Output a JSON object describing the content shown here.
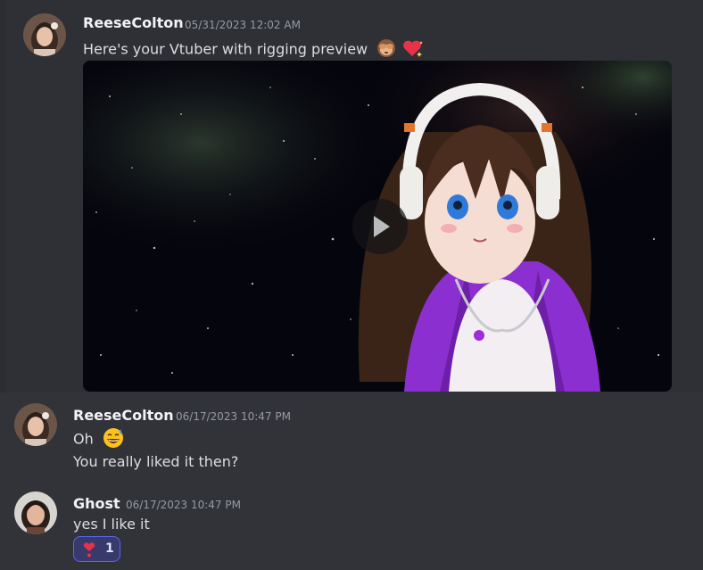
{
  "messages": [
    {
      "username": "ReeseColton",
      "timestamp": "05/31/2023 12:02 AM",
      "text": "Here's your Vtuber with rigging preview",
      "emojis": [
        "see-no-evil-monkey",
        "sparkling-heart"
      ],
      "attachment": {
        "type": "video",
        "icon": "play-icon"
      }
    },
    {
      "username": "ReeseColton",
      "timestamp": "06/17/2023 10:47 PM",
      "lines": [
        "Oh",
        "You really liked it then?"
      ],
      "emoji": "grinning-sweat-face"
    },
    {
      "username": "Ghost",
      "timestamp": "06/17/2023 10:47 PM",
      "text": "yes I like it",
      "reaction": {
        "emoji": "heart-exclamation",
        "count": "1"
      }
    }
  ],
  "colors": {
    "background": "#313338",
    "username": "#f2f3f5",
    "timestamp": "#949ba4",
    "reaction_border": "#5865f2",
    "reaction_bg": "#373a6b"
  }
}
